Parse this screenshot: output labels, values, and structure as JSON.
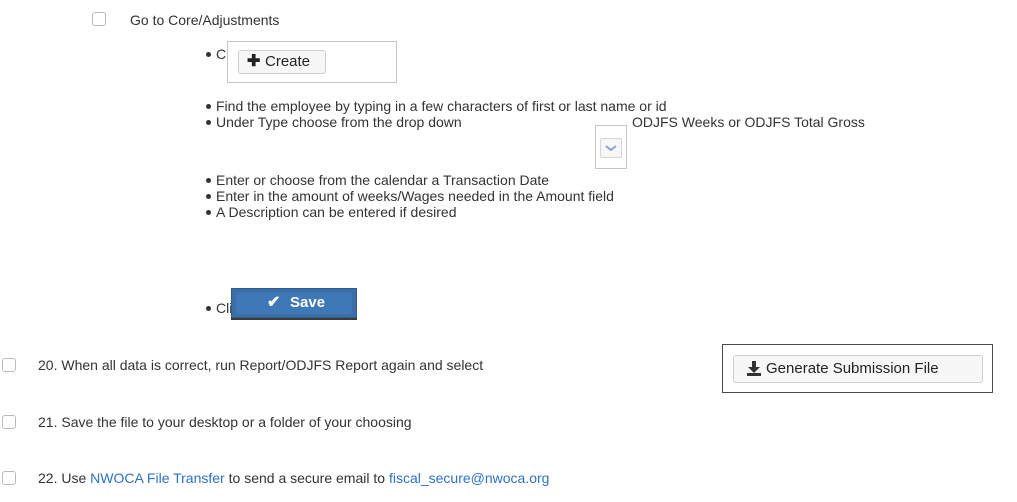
{
  "steps": {
    "core": {
      "label": "Go to Core/Adjustments"
    },
    "sub": {
      "click1": "Click",
      "create_label": "Create",
      "find": "Find the employee by typing in a few characters of first or last name or id",
      "type_prefix": "Under Type choose from the drop down",
      "type_suffix": "ODJFS Weeks or ODJFS Total Gross",
      "date": "Enter or choose from the calendar a Transaction Date",
      "amount": "Enter in the amount of weeks/Wages needed in the Amount field",
      "desc": "A Description can be entered if desired",
      "click2": "Click",
      "save_label": "Save"
    },
    "step20": {
      "text": "20. When all data is correct, run Report/ODJFS Report again and select",
      "button_label": "Generate Submission File"
    },
    "step21": {
      "text": "21. Save the file to your desktop or a folder of your choosing"
    },
    "step22": {
      "prefix": "22. Use ",
      "link1": "NWOCA File Transfer",
      "middle": " to send a secure email to ",
      "link2": "fiscal_secure@nwoca.org"
    }
  },
  "icons": {
    "checkbox": "checkbox-icon",
    "plus": "plus-icon",
    "chevron": "chevron-down-icon",
    "check": "checkmark-icon",
    "download": "download-icon"
  },
  "colors": {
    "link": "#2d72c4",
    "save_button": "#3f78b6",
    "text": "#333333"
  }
}
